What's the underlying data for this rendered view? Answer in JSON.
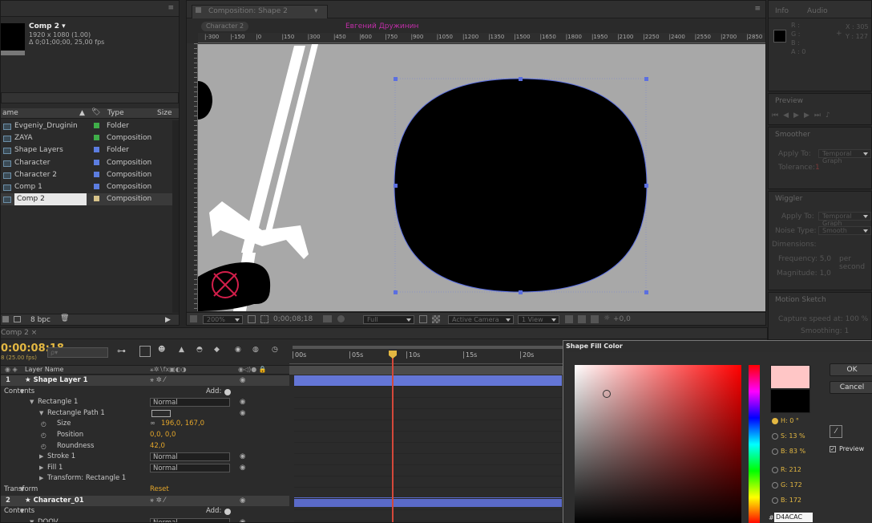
{
  "project": {
    "comp_name": "Comp 2 ▾",
    "comp_size": "1920 x 1080 (1.00)",
    "comp_duration": "Δ 0;01;00;00, 25,00 fps",
    "header_name": "ame",
    "header_type": "Type",
    "header_size": "Size",
    "items": [
      {
        "name": "Evgeniy_Druginin",
        "color": "#3fae49",
        "type": "Folder",
        "icon": "folder-icon"
      },
      {
        "name": "ZAYA",
        "color": "#3fae49",
        "type": "Composition",
        "icon": "composition-icon"
      },
      {
        "name": "Shape Layers",
        "color": "#5c7de0",
        "type": "Folder",
        "icon": "folder-icon"
      },
      {
        "name": "Character",
        "color": "#5c7de0",
        "type": "Composition",
        "icon": "composition-icon"
      },
      {
        "name": "Character 2",
        "color": "#5c7de0",
        "type": "Composition",
        "icon": "composition-icon"
      },
      {
        "name": "Comp 1",
        "color": "#5c7de0",
        "type": "Composition",
        "icon": "composition-icon"
      },
      {
        "name": "Comp 2",
        "color": "#d7c38a",
        "type": "Composition",
        "icon": "composition-icon"
      }
    ],
    "footer_bpc": "8 bpc"
  },
  "composition": {
    "tab_label": "Composition: Shape 2",
    "breadcrumb": "Character 2",
    "top_label": "Евгений Дружинин",
    "ruler_labels": [
      "|-300",
      "|-150",
      "|0",
      "|150",
      "|300",
      "|450",
      "|600",
      "|750",
      "|900",
      "|1050",
      "|1200",
      "|1350",
      "|1500",
      "|1650",
      "|1800",
      "|1950",
      "|2100",
      "|2250",
      "|2400",
      "|2550",
      "|2700",
      "|2850"
    ],
    "zoom": "200%",
    "timecode": "0;00;08;18",
    "resolution": "Full",
    "camera": "Active Camera",
    "views": "1 View",
    "exposure": "+0,0"
  },
  "info_panel": {
    "tabs": [
      "Info",
      "Audio"
    ],
    "values": [
      "R :",
      "G :",
      "B :",
      "A : 0"
    ],
    "coords": [
      "X : 305",
      "Y : 127"
    ]
  },
  "preview_panel": {
    "title": "Preview"
  },
  "smoother_panel": {
    "title": "Smoother",
    "apply_to": "Apply To:",
    "apply_value": "Temporal Graph",
    "tolerance": "Tolerance:",
    "tolerance_value": "1"
  },
  "wiggler_panel": {
    "title": "Wiggler",
    "apply_to": "Apply To:",
    "apply_value": "Temporal Graph",
    "noise_type": "Noise Type:",
    "noise_value": "Smooth",
    "dimensions": "Dimensions:",
    "frequency": "Frequency: 5,0",
    "per_second": "per second",
    "magnitude": "Magnitude: 1,0"
  },
  "motion_sketch": {
    "title": "Motion Sketch",
    "capture": "Capture speed at: 100 %",
    "smoothing": "Smoothing: 1"
  },
  "timeline": {
    "tab": "Comp 2 ×",
    "timecode": "0:00:08:18",
    "fps_info": "8 (25.00 fps)",
    "search_placeholder": "ρ▾",
    "layer_name_header": "Layer Name",
    "mode_header": "Mode",
    "time_labels": [
      "00s",
      "05s",
      "10s",
      "15s",
      "20s"
    ],
    "rows": [
      {
        "indent": 0,
        "num": "1",
        "label": "★ Shape Layer 1",
        "kind": "layer",
        "value": ""
      },
      {
        "indent": 1,
        "num": "",
        "label": "Contents",
        "kind": "group",
        "value": "Add:"
      },
      {
        "indent": 2,
        "num": "",
        "label": "Rectangle 1",
        "kind": "prop",
        "value": "Normal"
      },
      {
        "indent": 3,
        "num": "",
        "label": "Rectangle Path 1",
        "kind": "prop",
        "value": ""
      },
      {
        "indent": 4,
        "num": "",
        "label": "Size",
        "kind": "val",
        "value": "196,0, 167,0"
      },
      {
        "indent": 4,
        "num": "",
        "label": "Position",
        "kind": "val",
        "value": "0,0, 0,0"
      },
      {
        "indent": 4,
        "num": "",
        "label": "Roundness",
        "kind": "val",
        "value": "42,0"
      },
      {
        "indent": 3,
        "num": "",
        "label": "Stroke 1",
        "kind": "prop",
        "value": "Normal"
      },
      {
        "indent": 3,
        "num": "",
        "label": "Fill 1",
        "kind": "prop",
        "value": "Normal"
      },
      {
        "indent": 3,
        "num": "",
        "label": "Transform: Rectangle 1",
        "kind": "prop",
        "value": ""
      },
      {
        "indent": 1,
        "num": "",
        "label": "Transform",
        "kind": "group",
        "value": "Reset"
      },
      {
        "indent": 0,
        "num": "2",
        "label": "★ Character_01",
        "kind": "layer",
        "value": ""
      },
      {
        "indent": 1,
        "num": "",
        "label": "Contents",
        "kind": "group",
        "value": "Add:"
      },
      {
        "indent": 2,
        "num": "",
        "label": "DOOV",
        "kind": "prop",
        "value": "Normal"
      }
    ]
  },
  "color_dialog": {
    "title": "Shape Fill Color",
    "ok": "OK",
    "cancel": "Cancel",
    "preview": "Preview",
    "h": "H: 0 °",
    "s": "S: 13 %",
    "b": "B: 83 %",
    "r": "R: 212",
    "g": "G: 172",
    "bl": "B: 172",
    "hex": "D4ACAC",
    "new_color": "#ffc6c6",
    "old_color": "#000000"
  }
}
